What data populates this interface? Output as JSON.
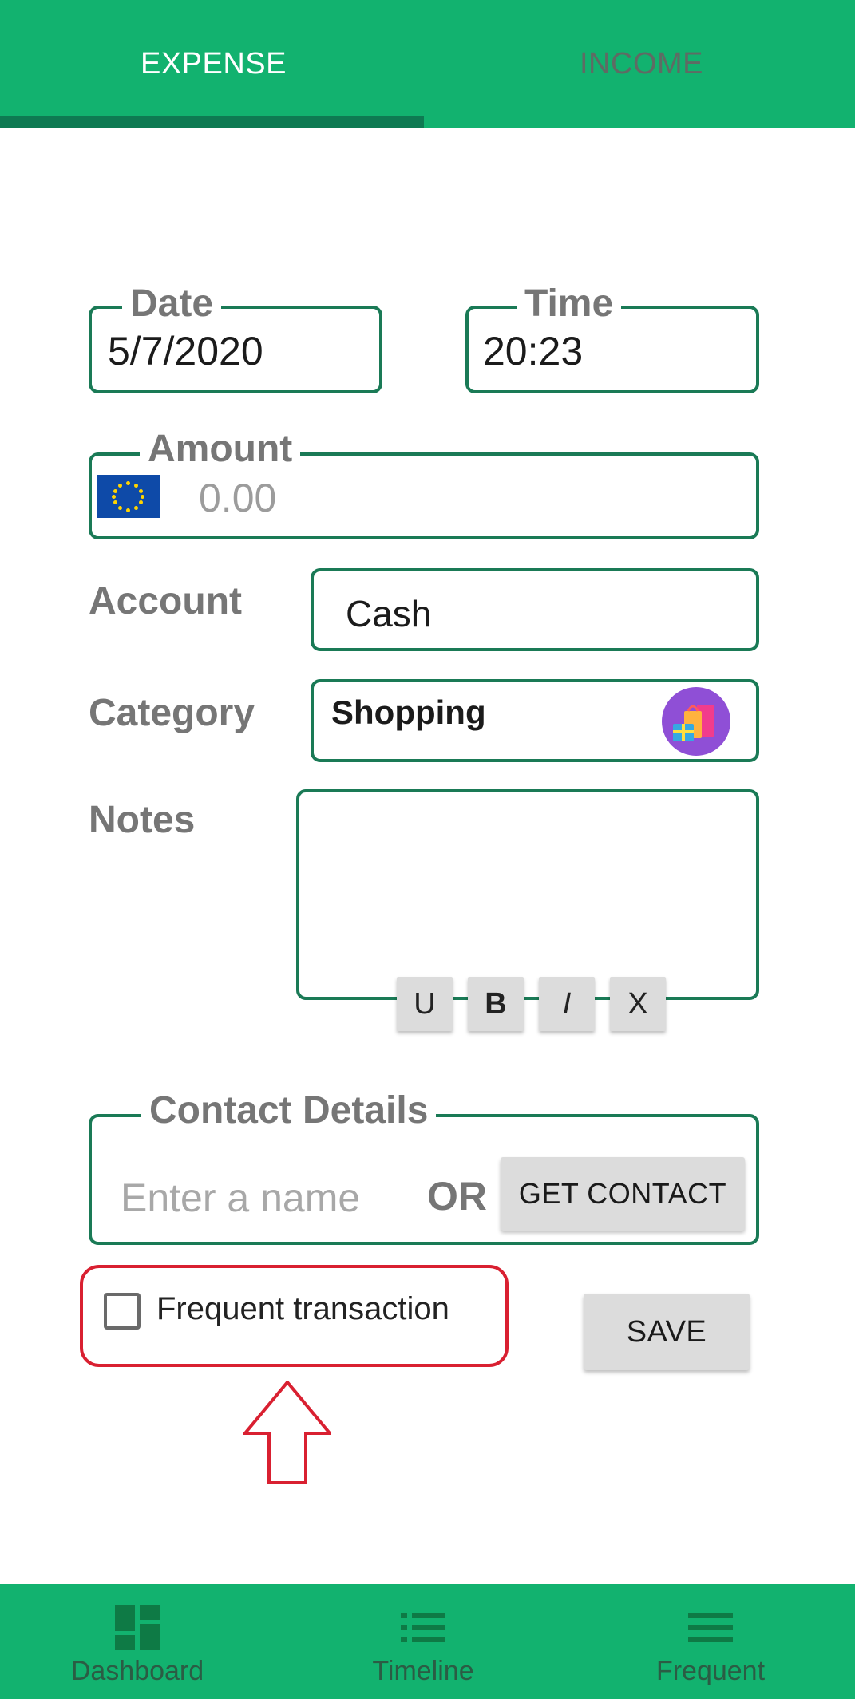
{
  "tabs": {
    "expense": "EXPENSE",
    "income": "INCOME"
  },
  "form": {
    "date_label": "Date",
    "date_value": "5/7/2020",
    "time_label": "Time",
    "time_value": "20:23",
    "amount_label": "Amount",
    "amount_placeholder": "0.00",
    "currency_icon": "eu-flag-icon",
    "account_label": "Account",
    "account_value": "Cash",
    "category_label": "Category",
    "category_value": "Shopping",
    "category_icon": "shopping-bags-icon",
    "notes_label": "Notes",
    "notes_value": "",
    "format_buttons": [
      "U",
      "B",
      "I",
      "X"
    ]
  },
  "contact": {
    "legend": "Contact Details",
    "name_placeholder": "Enter a name",
    "or_text": "OR",
    "get_contact_label": "GET CONTACT"
  },
  "frequent": {
    "label": "Frequent transaction",
    "checked": false
  },
  "save_label": "SAVE",
  "bottom_nav": [
    {
      "label": "Dashboard",
      "icon": "dashboard-icon"
    },
    {
      "label": "Timeline",
      "icon": "list-icon"
    },
    {
      "label": "Frequent",
      "icon": "menu-icon"
    }
  ],
  "colors": {
    "primary": "#12b26f",
    "primary_dark": "#0e7a52",
    "field_border": "#1a7a56",
    "annotation_red": "#d92031"
  }
}
